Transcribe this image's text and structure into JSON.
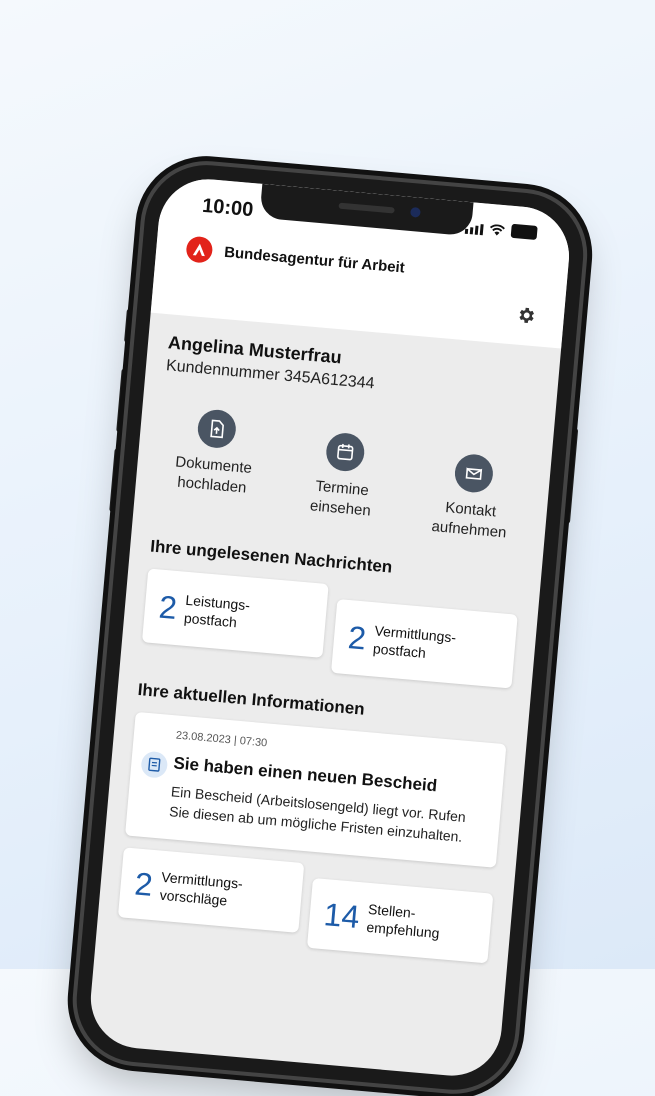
{
  "status_bar": {
    "time": "10:00"
  },
  "header": {
    "brand": "Bundesagentur für Arbeit"
  },
  "user": {
    "name": "Angelina Musterfrau",
    "customer_number": "Kundennummer 345A612344"
  },
  "actions": [
    {
      "label": "Dokumente\nhochladen",
      "icon": "document-upload-icon"
    },
    {
      "label": "Termine\neinsehen",
      "icon": "calendar-icon"
    },
    {
      "label": "Kontakt\naufnehmen",
      "icon": "contact-icon"
    }
  ],
  "messages": {
    "heading": "Ihre ungelesenen Nachrichten",
    "cards": [
      {
        "count": "2",
        "label": "Leistungs-\npostfach"
      },
      {
        "count": "2",
        "label": "Vermittlungs-\npostfach"
      }
    ]
  },
  "info": {
    "heading": "Ihre aktuellen Informationen",
    "card": {
      "date": "23.08.2023 | 07:30",
      "title": "Sie haben einen neuen Bescheid",
      "text": "Ein Bescheid (Arbeitslosengeld) liegt vor. Rufen Sie diesen ab um mögliche Fristen einzuhalten."
    },
    "cards": [
      {
        "count": "2",
        "label": "Vermittlungs-\nvorschläge"
      },
      {
        "count": "14",
        "label": "Stellen-\nempfehlung"
      }
    ]
  },
  "colors": {
    "brand_red": "#e2231a",
    "accent_blue": "#1d5ba8",
    "icon_bg": "#4a5563"
  }
}
